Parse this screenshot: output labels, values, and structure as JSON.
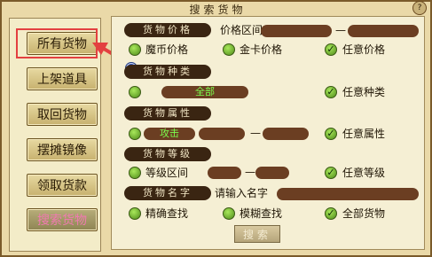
{
  "window": {
    "title": "搜索货物",
    "corner_icon": "?"
  },
  "sidebar": {
    "items": [
      {
        "label": "所有货物"
      },
      {
        "label": "上架道具"
      },
      {
        "label": "取回货物"
      },
      {
        "label": "摆摊镜像"
      },
      {
        "label": "领取货款"
      },
      {
        "label": "搜索货物"
      }
    ]
  },
  "filters": {
    "price": {
      "section": "货物价格",
      "range_label": "价格区间",
      "dash": "—",
      "options": [
        "魔币价格",
        "金卡价格",
        "任意价格"
      ]
    },
    "type": {
      "section": "货物种类",
      "selected_value": "全部",
      "any_option": "任意种类"
    },
    "attribute": {
      "section": "货物属性",
      "selected_value": "攻击",
      "dash": "—",
      "any_option": "任意属性"
    },
    "level": {
      "section": "货物等级",
      "range_label": "等级区间",
      "dash": "—",
      "any_option": "任意等级"
    },
    "name": {
      "section": "货物名字",
      "input_label": "请输入名字",
      "options": [
        "精确查找",
        "模糊查找",
        "全部货物"
      ]
    }
  },
  "search_button": {
    "label": "搜索"
  },
  "colors": {
    "annotation": "#e34040",
    "section_bg": "#3a2512",
    "field_bg": "#6b3e22"
  }
}
